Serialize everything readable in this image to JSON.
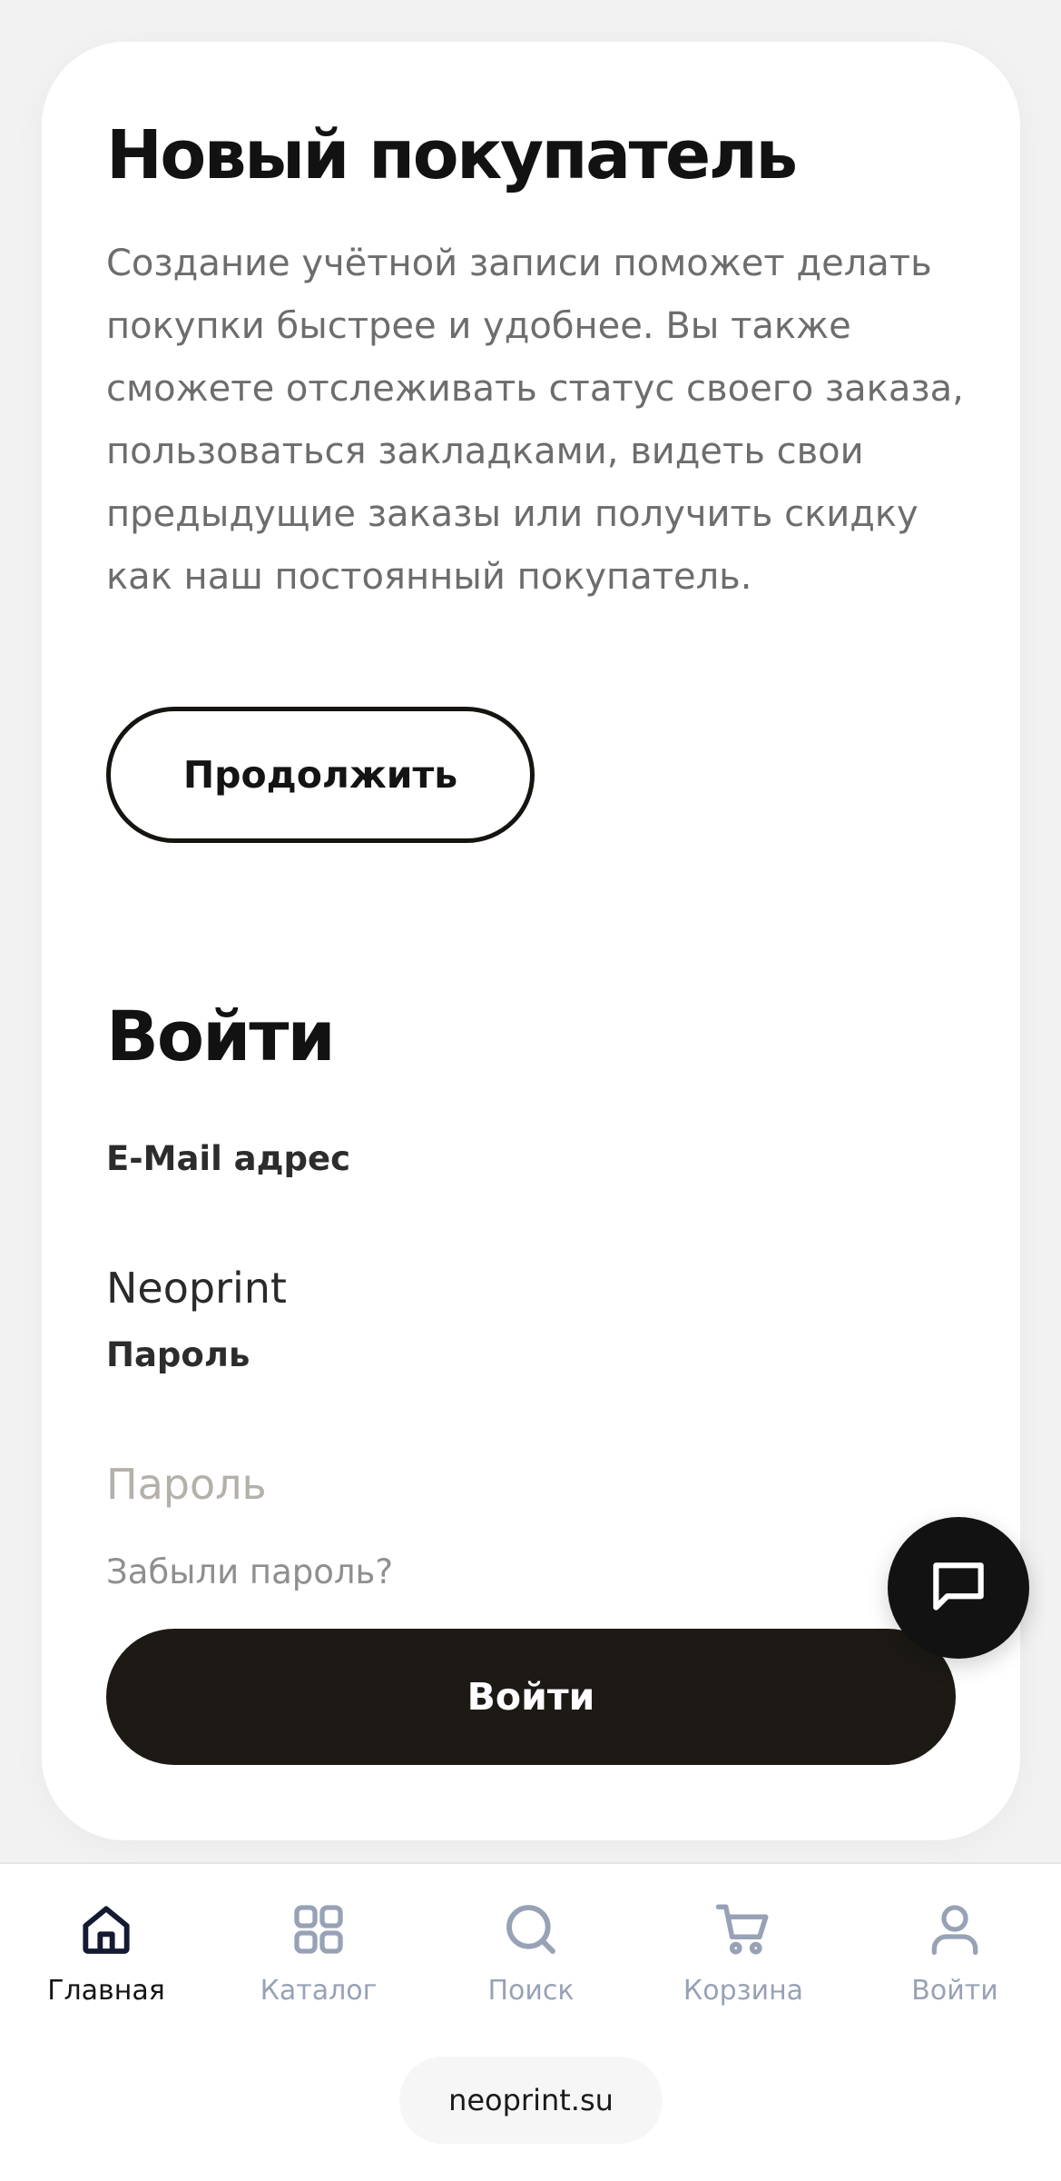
{
  "new_customer": {
    "title": "Новый покупатель",
    "description": "Создание учётной записи поможет делать покупки быстрее и удобнее. Вы также сможете отслеживать статус своего заказа, пользоваться закладками, видеть свои предыдущие заказы или получить скидку как наш постоянный покупатель.",
    "continue_label": "Продолжить"
  },
  "login": {
    "title": "Войти",
    "email_label": "E-Mail адрес",
    "email_value": "Neoprint",
    "password_label": "Пароль",
    "password_placeholder": "Пароль",
    "forgot_label": "Забыли пароль?",
    "submit_label": "Войти"
  },
  "chat": {
    "icon": "chat-bubble-icon"
  },
  "bottom_nav": {
    "items": [
      {
        "label": "Главная",
        "icon": "home-icon",
        "active": true
      },
      {
        "label": "Каталог",
        "icon": "grid-icon",
        "active": false
      },
      {
        "label": "Поиск",
        "icon": "search-icon",
        "active": false
      },
      {
        "label": "Корзина",
        "icon": "cart-icon",
        "active": false
      },
      {
        "label": "Войти",
        "icon": "user-icon",
        "active": false
      }
    ]
  },
  "browser": {
    "url": "neoprint.su"
  },
  "colors": {
    "accent_dark": "#1d1a15",
    "nav_inactive": "#98a2b6",
    "nav_active": "#141414",
    "description_text": "#6d6d6d"
  }
}
